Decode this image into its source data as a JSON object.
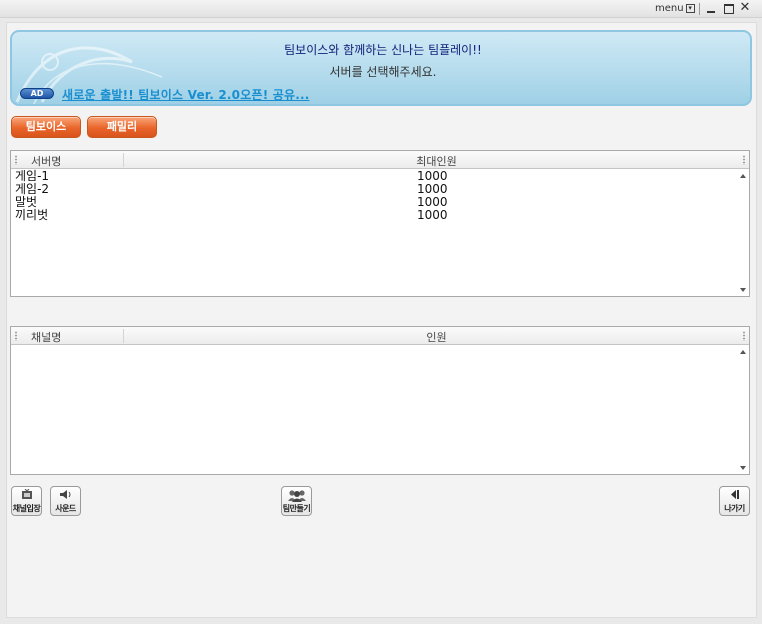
{
  "titlebar": {
    "menu_label": "menu"
  },
  "banner": {
    "title": "팀보이스와 함께하는 신나는 팀플레이!!",
    "subtitle": "서버를 선택해주세요.",
    "ad_badge": "AD",
    "ad_link": "새로운 출발!! 팀보이스 Ver. 2.0오픈! 공유..."
  },
  "tabs": [
    {
      "label": "팀보이스"
    },
    {
      "label": "패밀리"
    }
  ],
  "server_list": {
    "columns": [
      "서버명",
      "최대인원"
    ],
    "rows": [
      {
        "name": "게임-1",
        "max": "1000"
      },
      {
        "name": "게임-2",
        "max": "1000"
      },
      {
        "name": "말벗",
        "max": "1000"
      },
      {
        "name": "끼리벗",
        "max": "1000"
      }
    ]
  },
  "channel_list": {
    "columns": [
      "채널명",
      "인원"
    ],
    "rows": []
  },
  "toolbar": {
    "enter_label": "채널입장",
    "sound_label": "사운드",
    "team_label": "팀만들기",
    "exit_label": "나가기"
  },
  "colors": {
    "accent_orange": "#e9652a",
    "banner_blue": "#b5dced",
    "link_blue": "#1a8fd0"
  }
}
